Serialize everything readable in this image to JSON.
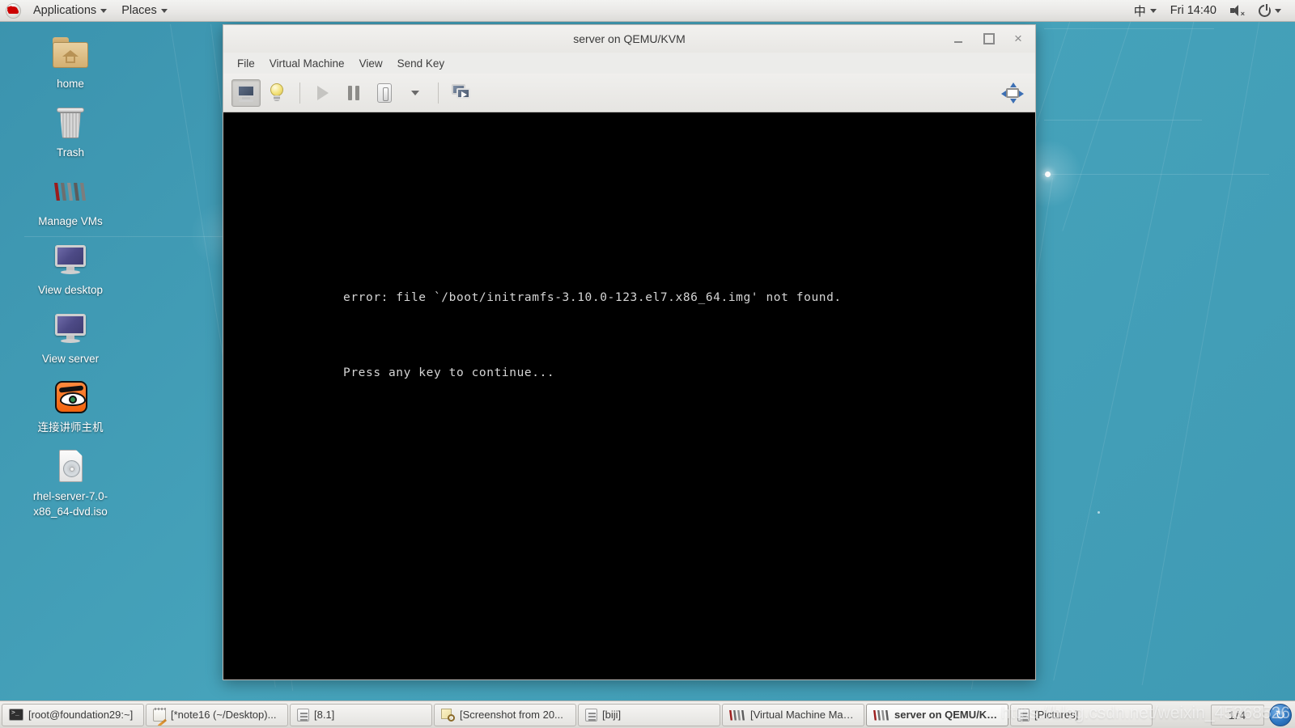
{
  "top_panel": {
    "logo_icon": "redhat-logo-icon",
    "applications_label": "Applications",
    "places_label": "Places",
    "input_method": "中",
    "clock": "Fri 14:40",
    "volume_icon": "speaker-muted-icon",
    "power_icon": "power-icon"
  },
  "desktop_icons": [
    {
      "label": "home",
      "icon": "home-folder-icon"
    },
    {
      "label": "Trash",
      "icon": "trash-icon"
    },
    {
      "label": "Manage VMs",
      "icon": "virt-manager-icon"
    },
    {
      "label": "View desktop",
      "icon": "monitor-icon"
    },
    {
      "label": "View server",
      "icon": "monitor-icon"
    },
    {
      "label": "连接讲师主机",
      "icon": "vnc-eye-icon"
    },
    {
      "label": "rhel-server-7.0-x86_64-dvd.iso",
      "icon": "iso-disc-icon"
    }
  ],
  "vm_window": {
    "title": "server on QEMU/KVM",
    "window_buttons": {
      "minimize": "_",
      "maximize": "□",
      "close": "×"
    },
    "menus": [
      "File",
      "Virtual Machine",
      "View",
      "Send Key"
    ],
    "toolbar": [
      {
        "name": "console-view-button",
        "icon": "console-icon",
        "state": "active"
      },
      {
        "name": "details-view-button",
        "icon": "lightbulb-icon",
        "state": "normal"
      },
      {
        "name": "run-button",
        "icon": "play-icon",
        "state": "disabled"
      },
      {
        "name": "pause-button",
        "icon": "pause-icon",
        "state": "normal"
      },
      {
        "name": "shutdown-button",
        "icon": "shutdown-icon",
        "state": "normal"
      },
      {
        "name": "shutdown-dropdown",
        "icon": "chevron-down-icon",
        "state": "normal"
      },
      {
        "name": "snapshots-button",
        "icon": "snapshot-icon",
        "state": "normal"
      },
      {
        "name": "fullscreen-button",
        "icon": "fullscreen-icon",
        "state": "normal"
      }
    ],
    "console": {
      "line1": "error: file `/boot/initramfs-3.10.0-123.el7.x86_64.img' not found.",
      "line2": "Press any key to continue..."
    }
  },
  "taskbar": {
    "items": [
      {
        "label": "[root@foundation29:~]",
        "icon": "terminal-icon",
        "active": false
      },
      {
        "label": "[*note16 (~/Desktop)...",
        "icon": "notepad-icon",
        "active": false
      },
      {
        "label": "[8.1]",
        "icon": "file-icon",
        "active": false
      },
      {
        "label": "[Screenshot from 20...",
        "icon": "screenshot-icon",
        "active": false
      },
      {
        "label": "[biji]",
        "icon": "file-icon",
        "active": false
      },
      {
        "label": "[Virtual Machine Man...",
        "icon": "virt-manager-icon",
        "active": false
      },
      {
        "label": "server on QEMU/KVM",
        "icon": "virt-manager-icon",
        "active": true
      },
      {
        "label": "[Pictures]",
        "icon": "file-icon",
        "active": false
      }
    ],
    "workspace": "1/4",
    "tray_icon": "workspace-switcher-icon"
  },
  "watermark": "https://blog.csdn.net/weixin_45368526",
  "colors": {
    "desktop": "#46a3bb",
    "panel": "#ececea",
    "console_bg": "#000000",
    "console_fg": "#d5d5d5",
    "accent": "#cc0000"
  }
}
